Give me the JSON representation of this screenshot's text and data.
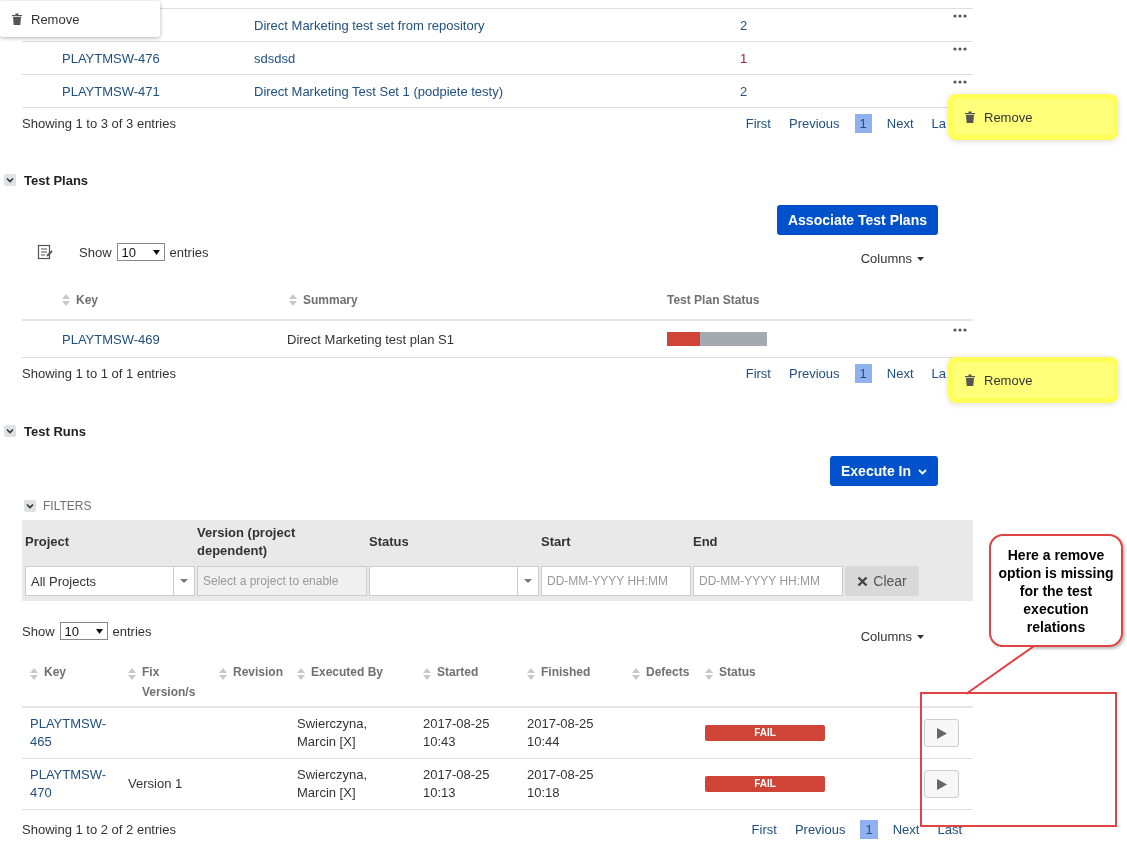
{
  "test_sets": {
    "rows": [
      {
        "summary": "Direct Marketing test set from repository",
        "count": "2",
        "color": "#205081"
      },
      {
        "key": "PLAYTMSW-476",
        "summary": "sdsdsd",
        "count": "1",
        "color": "#a0223a"
      },
      {
        "key": "PLAYTMSW-471",
        "summary": "Direct Marketing Test Set 1 (podpiete testy)",
        "count": "2",
        "color": "#205081"
      }
    ],
    "footer": "Showing 1 to 3 of 3 entries",
    "pagination": [
      {
        "label": "First",
        "selected": false
      },
      {
        "label": "Previous",
        "selected": false
      },
      {
        "label": "1",
        "selected": true
      },
      {
        "label": "Next",
        "selected": false
      },
      {
        "label": "La",
        "selected": false
      }
    ]
  },
  "test_plans": {
    "title": "Test Plans",
    "expanded": true,
    "button": "Associate Test Plans",
    "show_label": "Show",
    "page_size": "10",
    "entries_label": "entries",
    "columns_button": "Columns",
    "columns": [
      {
        "label": "Key",
        "sortable": true
      },
      {
        "label": "Summary",
        "sortable": true
      },
      {
        "label": "Test Plan Status",
        "sortable": false
      }
    ],
    "rows": [
      {
        "key": "PLAYTMSW-469",
        "summary": "Direct Marketing test plan S1",
        "level": 0.33
      }
    ],
    "footer": "Showing 1 to 1 of 1 entries",
    "pagination": [
      {
        "label": "First",
        "selected": false
      },
      {
        "label": "Previous",
        "selected": false
      },
      {
        "label": "1",
        "selected": true
      },
      {
        "label": "Next",
        "selected": false
      },
      {
        "label": "La",
        "selected": false
      }
    ]
  },
  "test_runs": {
    "title": "Test Runs",
    "expanded": true,
    "button": "Execute In",
    "filters": {
      "label": "FILTERS",
      "expanded": true,
      "fields": [
        {
          "label": "Project",
          "kind": "select",
          "value": "All Projects",
          "disabled": false
        },
        {
          "label": "Version (project dependent)",
          "kind": "text",
          "placeholder": "Select a project to enable",
          "disabled": true
        },
        {
          "label": "Status",
          "kind": "select",
          "disabled": false
        },
        {
          "label": "Start",
          "kind": "text",
          "placeholder": "DD-MM-YYYY HH:MM",
          "disabled": false
        },
        {
          "label": "End",
          "kind": "text",
          "placeholder": "DD-MM-YYYY HH:MM",
          "disabled": false
        }
      ],
      "clear_button": "Clear"
    },
    "show_label": "Show",
    "page_size": "10",
    "entries_label": "entries",
    "columns_button": "Columns",
    "columns": [
      {
        "label": "Key"
      },
      {
        "label": "Fix Version/s"
      },
      {
        "label": "Revision"
      },
      {
        "label": "Executed By"
      },
      {
        "label": "Started"
      },
      {
        "label": "Finished"
      },
      {
        "label": "Defects"
      },
      {
        "label": "Status"
      }
    ],
    "rows": [
      {
        "key": "PLAYTMSW-465",
        "executed_by": "Swierczyna, Marcin [X]",
        "started": "2017-08-25 10:43",
        "finished": "2017-08-25 10:44",
        "status": "FAIL",
        "color": "#d04437"
      },
      {
        "key": "PLAYTMSW-470",
        "fix_version": "Version 1",
        "executed_by": "Swierczyna, Marcin [X]",
        "started": "2017-08-25 10:13",
        "finished": "2017-08-25 10:18",
        "status": "FAIL",
        "color": "#d04437"
      }
    ],
    "footer": "Showing 1 to 2 of 2 entries",
    "pagination": [
      {
        "label": "First",
        "selected": false
      },
      {
        "label": "Previous",
        "selected": false
      },
      {
        "label": "1",
        "selected": true
      },
      {
        "label": "Next",
        "selected": false
      },
      {
        "label": "Last",
        "selected": false
      }
    ]
  },
  "context_menus": [
    {
      "label": "Remove",
      "highlighted": false
    },
    {
      "label": "Remove",
      "highlighted": true
    },
    {
      "label": "Remove",
      "highlighted": true
    }
  ],
  "annotation": {
    "text": "Here a remove option is missing for the test execution relations"
  }
}
